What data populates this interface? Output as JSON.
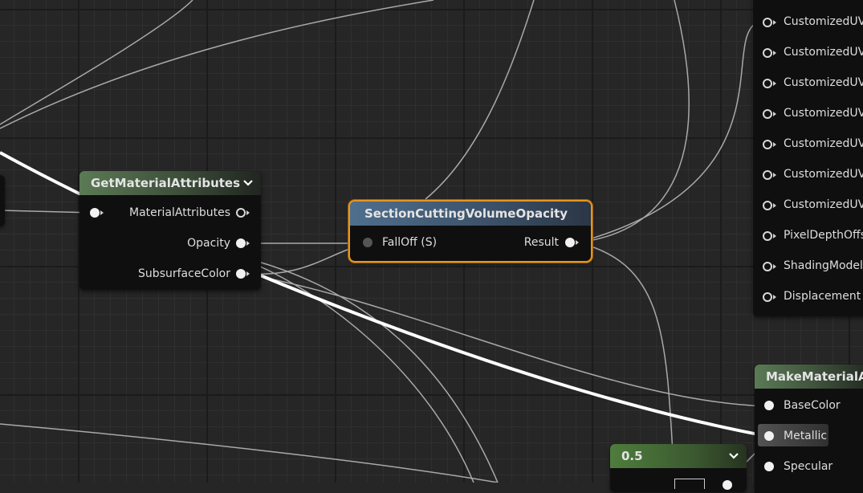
{
  "nodes": {
    "get_material_attributes": {
      "title": "GetMaterialAttributes",
      "pins": {
        "material_attributes": "MaterialAttributes",
        "opacity": "Opacity",
        "subsurface_color": "SubsurfaceColor"
      }
    },
    "section_cutting": {
      "title": "SectionCuttingVolumeOpacity",
      "pins": {
        "falloff": "FallOff (S)",
        "result": "Result"
      }
    },
    "output_list": {
      "pins": [
        "CustomizedUV",
        "CustomizedUV",
        "CustomizedUV",
        "CustomizedUV",
        "CustomizedUV",
        "CustomizedUV",
        "CustomizedUV",
        "PixelDepthOffs",
        "ShadingModel",
        "Displacement"
      ]
    },
    "make_material_attributes": {
      "title": "MakeMaterialAt",
      "pins": {
        "base_color": "BaseColor",
        "metallic": "Metallic",
        "specular": "Specular"
      }
    },
    "constant": {
      "title": "0.5"
    }
  },
  "colors": {
    "background": "#262626",
    "selection_outline": "#e8951f",
    "wire": "#c8c8c8"
  }
}
